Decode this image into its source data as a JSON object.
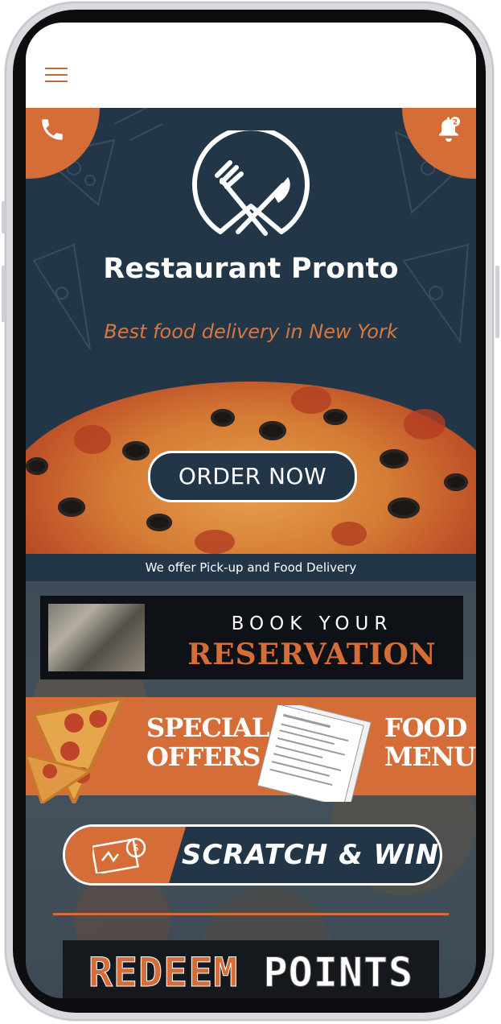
{
  "header": {
    "menu_icon": "hamburger-menu-icon"
  },
  "hero": {
    "call_icon": "phone-icon",
    "notification_icon": "bell-icon",
    "notification_count": "2",
    "logo_icon": "fork-knife-logo-icon",
    "title": "Restaurant Pronto",
    "tagline": "Best food delivery in New York"
  },
  "order": {
    "label": "ORDER NOW"
  },
  "service_note": "We offer Pick-up and Food Delivery",
  "reservation": {
    "top": "BOOK YOUR",
    "main": "RESERVATION"
  },
  "offers": {
    "line1": "SPECIAL",
    "line2": "OFFERS"
  },
  "menu": {
    "line1": "FOOD",
    "line2": "MENU"
  },
  "scratch": {
    "label": "SCRATCH & WIN",
    "icon": "ticket-coin-icon"
  },
  "redeem": {
    "word1": "REDEEM",
    "word2": "POINTS"
  },
  "colors": {
    "accent": "#d46d38",
    "navy": "#223648",
    "white": "#ffffff"
  }
}
